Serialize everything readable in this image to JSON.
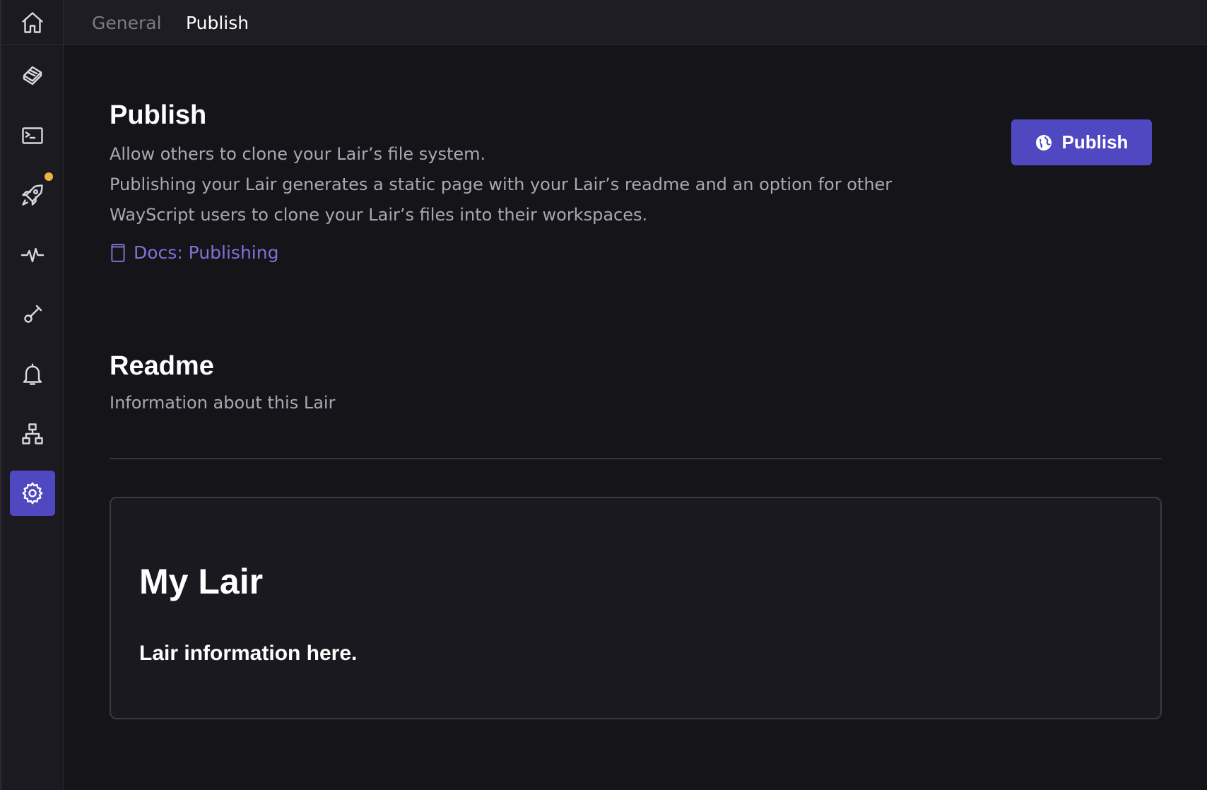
{
  "sidebar": {
    "items": [
      {
        "name": "home-icon"
      },
      {
        "name": "files-icon"
      },
      {
        "name": "terminal-icon"
      },
      {
        "name": "rocket-icon",
        "has_notification": true
      },
      {
        "name": "activity-icon"
      },
      {
        "name": "key-icon"
      },
      {
        "name": "bell-icon"
      },
      {
        "name": "hierarchy-icon"
      },
      {
        "name": "gear-icon",
        "active": true
      }
    ],
    "accent_color": "#5048c0",
    "notification_color": "#f0b23e"
  },
  "topbar": {
    "tabs": [
      {
        "label": "General",
        "active": false
      },
      {
        "label": "Publish",
        "active": true
      }
    ]
  },
  "publish": {
    "title": "Publish",
    "description_line1": "Allow others to clone your Lair’s file system.",
    "description_line2": "Publishing your Lair generates a static page with your Lair’s readme and an option for other WayScript users to clone your Lair’s files into their workspaces.",
    "docs_link": "Docs: Publishing",
    "button_label": "Publish"
  },
  "readme": {
    "title": "Readme",
    "subtitle": "Information about this Lair",
    "content_title": "My Lair",
    "content_body": "Lair information here."
  }
}
